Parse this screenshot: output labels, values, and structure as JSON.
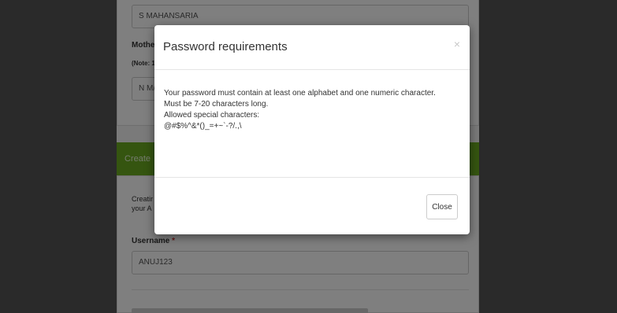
{
  "background_form": {
    "last_name_value": "S MAHANSARIA",
    "mother_label_partial": "Mothe",
    "note_partial": "(Note: 1",
    "mother_value_partial": "N M/",
    "section_header_partial": "Create",
    "intro_line1_partial": "Creatir",
    "intro_line2_partial": "your A",
    "username_label": "Username",
    "required_mark": "*",
    "username_value": "ANUJ123"
  },
  "modal": {
    "title": "Password requirements",
    "close_x": "×",
    "lines": [
      "Your password must contain at least one alphabet and one numeric character.",
      "Must be 7-20 characters long.",
      "Allowed special characters:",
      "@#$%^&*()_=+~`-?/.,\\"
    ],
    "close_button_label": "Close"
  }
}
